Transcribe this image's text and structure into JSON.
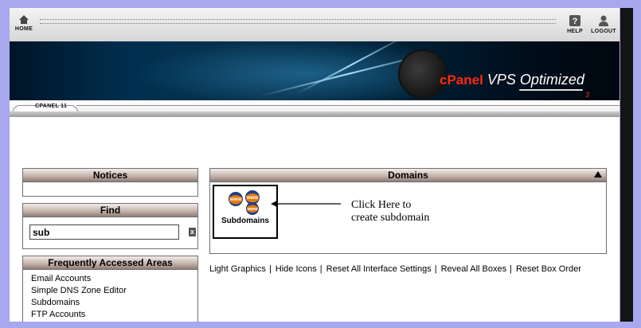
{
  "topbar": {
    "home_label": "HOME",
    "help_label": "HELP",
    "logout_label": "LOGOUT"
  },
  "banner": {
    "brand": "cPanel",
    "product": "VPS Optimized",
    "suffix": "3"
  },
  "version_label": "CPANEL 11",
  "notices": {
    "title": "Notices"
  },
  "find": {
    "title": "Find",
    "value": "sub",
    "clear_label": "x"
  },
  "frequent": {
    "title": "Frequently Accessed Areas",
    "items": [
      "Email Accounts",
      "Simple DNS Zone Editor",
      "Subdomains",
      "FTP Accounts"
    ]
  },
  "domains": {
    "title": "Domains",
    "icon_label": "Subdomains",
    "note_line1": "Click Here to",
    "note_line2": "create subdomain"
  },
  "footer_links": {
    "light_graphics": "Light Graphics",
    "hide_icons": "Hide Icons",
    "reset_settings": "Reset All Interface Settings",
    "reveal_boxes": "Reveal All Boxes",
    "reset_order": "Reset Box Order"
  },
  "colors": {
    "page_bg": "#a8a8ee",
    "box_header": "#c6b5ae",
    "brand_red": "#ff2a10"
  }
}
